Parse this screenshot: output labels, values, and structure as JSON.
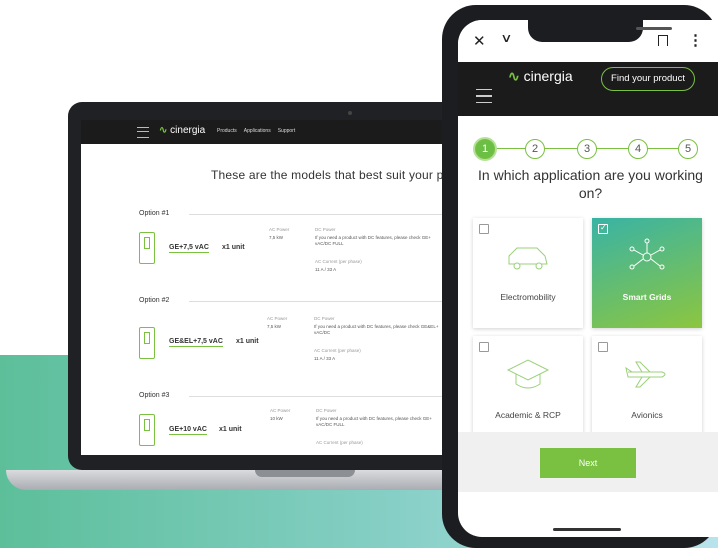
{
  "colors": {
    "brand_green": "#7ac142",
    "teal": "#39b3a5",
    "dark": "#1b1b1b"
  },
  "laptop": {
    "logo": "cinergia",
    "nav_links": [
      "Products",
      "Applications",
      "Support"
    ],
    "title": "These are the models that best suit your p",
    "options": [
      {
        "label": "Option #1",
        "model": "GE+7,5 vAC",
        "units": "x1 unit",
        "ac_power_label": "AC Power",
        "ac_power": "7,5 kW",
        "dc_power_label": "DC Power",
        "dc_text": "If you need a product with DC features, please check GE+ vAC/DC FULL",
        "ac_current_label": "AC Current (per phase)",
        "ac_current": "11 A / 33 A"
      },
      {
        "label": "Option #2",
        "model": "GE&EL+7,5 vAC",
        "units": "x1 unit",
        "ac_power_label": "AC Power",
        "ac_power": "7,5 kW",
        "dc_power_label": "DC Power",
        "dc_text": "If you need a product with DC features, please check GE&EL+ vAC/DC",
        "ac_current_label": "AC Current (per phase)",
        "ac_current": "11 A / 33 A"
      },
      {
        "label": "Option #3",
        "model": "GE+10 vAC",
        "units": "x1 unit",
        "ac_power_label": "AC Power",
        "ac_power": "10 kW",
        "dc_power_label": "DC Power",
        "dc_text": "If you need a product with DC features, please check GE+ vAC/DC FULL",
        "ac_current_label": "AC Current (per phase)",
        "ac_current": ""
      }
    ]
  },
  "phone": {
    "browser": {
      "close_icon": "close-icon",
      "chevron_icon": "chevron-down-icon",
      "bookmark_icon": "bookmark-icon",
      "menu_icon": "more-vert-icon"
    },
    "logo": "cinergia",
    "find_button": "Find your product",
    "steps": [
      "1",
      "2",
      "3",
      "4",
      "5"
    ],
    "active_step": 1,
    "question": "In which application are you working on?",
    "cards": [
      {
        "label": "Electromobility",
        "icon": "car-icon",
        "selected": false
      },
      {
        "label": "Smart Grids",
        "icon": "grid-network-icon",
        "selected": true
      },
      {
        "label": "Academic & RCP",
        "icon": "graduation-cap-icon",
        "selected": false
      },
      {
        "label": "Avionics",
        "icon": "airplane-icon",
        "selected": false
      }
    ],
    "next_button": "Next"
  }
}
